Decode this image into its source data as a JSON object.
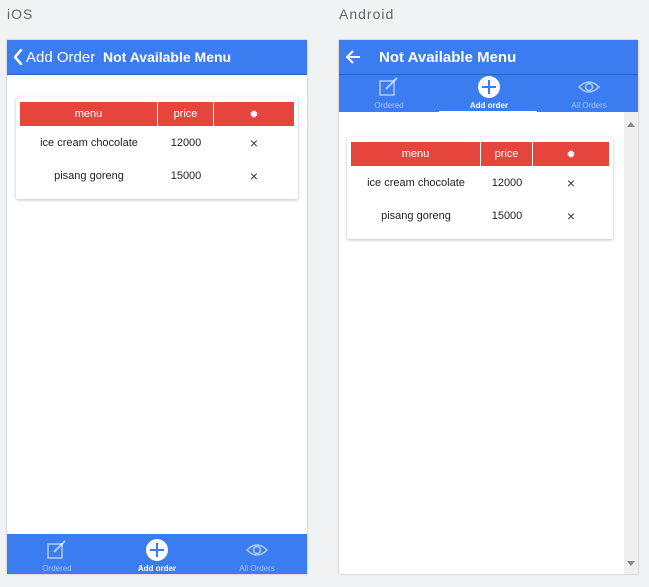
{
  "labels": {
    "ios": "iOS",
    "android": "Android"
  },
  "colors": {
    "primary": "#3b7df0",
    "table_header": "#e5453c"
  },
  "ios": {
    "back_label": "Add Order",
    "title": "Not Available Menu",
    "tabs": [
      {
        "label": "Ordered",
        "icon": "edit-icon",
        "active": false
      },
      {
        "label": "Add order",
        "icon": "add-circle-icon",
        "active": true
      },
      {
        "label": "All Orders",
        "icon": "eye-icon",
        "active": false
      }
    ]
  },
  "android": {
    "title": "Not Available Menu",
    "tabs": [
      {
        "label": "Ordered",
        "icon": "edit-icon",
        "active": false
      },
      {
        "label": "Add order",
        "icon": "add-circle-icon",
        "active": true
      },
      {
        "label": "All Orders",
        "icon": "eye-icon",
        "active": false
      }
    ]
  },
  "table": {
    "headers": {
      "menu": "menu",
      "price": "price",
      "action_icon": "gear-icon"
    },
    "rows": [
      {
        "menu": "ice cream chocolate",
        "price": "12000",
        "action": "×"
      },
      {
        "menu": "pisang goreng",
        "price": "15000",
        "action": "×"
      }
    ]
  }
}
